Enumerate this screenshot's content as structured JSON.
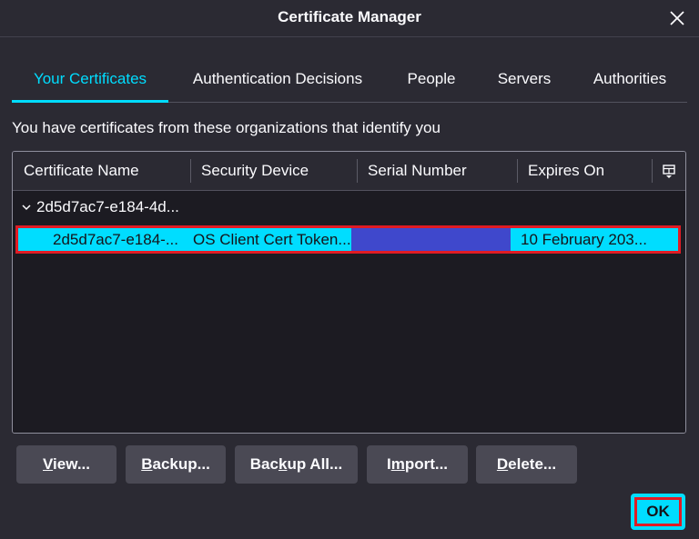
{
  "window": {
    "title": "Certificate Manager",
    "close_icon": "close-icon"
  },
  "tabs": [
    {
      "label": "Your Certificates",
      "active": true
    },
    {
      "label": "Authentication Decisions",
      "active": false
    },
    {
      "label": "People",
      "active": false
    },
    {
      "label": "Servers",
      "active": false
    },
    {
      "label": "Authorities",
      "active": false
    }
  ],
  "description": "You have certificates from these organizations that identify you",
  "table": {
    "columns": [
      "Certificate Name",
      "Security Device",
      "Serial Number",
      "Expires On"
    ],
    "column_picker_icon": "column-picker-icon",
    "group": {
      "label": "2d5d7ac7-e184-4d...",
      "expanded": true
    },
    "rows": [
      {
        "name": "2d5d7ac7-e184-...",
        "device": "OS Client Cert Token...",
        "serial": "",
        "expires": "10 February 203...",
        "selected": true
      }
    ]
  },
  "buttons": {
    "view": {
      "pre": "",
      "key": "V",
      "post": "iew..."
    },
    "backup": {
      "pre": "",
      "key": "B",
      "post": "ackup..."
    },
    "backup_all": {
      "pre": "Bac",
      "key": "k",
      "post": "up All..."
    },
    "import": {
      "pre": "I",
      "key": "m",
      "post": "port..."
    },
    "delete": {
      "pre": "",
      "key": "D",
      "post": "elete..."
    }
  },
  "ok_label": "OK",
  "colors": {
    "background": "#2b2a33",
    "accent": "#00ddff",
    "highlight_border": "#e01b24",
    "serial_redaction": "#3f48cc",
    "button": "#4a4954"
  }
}
